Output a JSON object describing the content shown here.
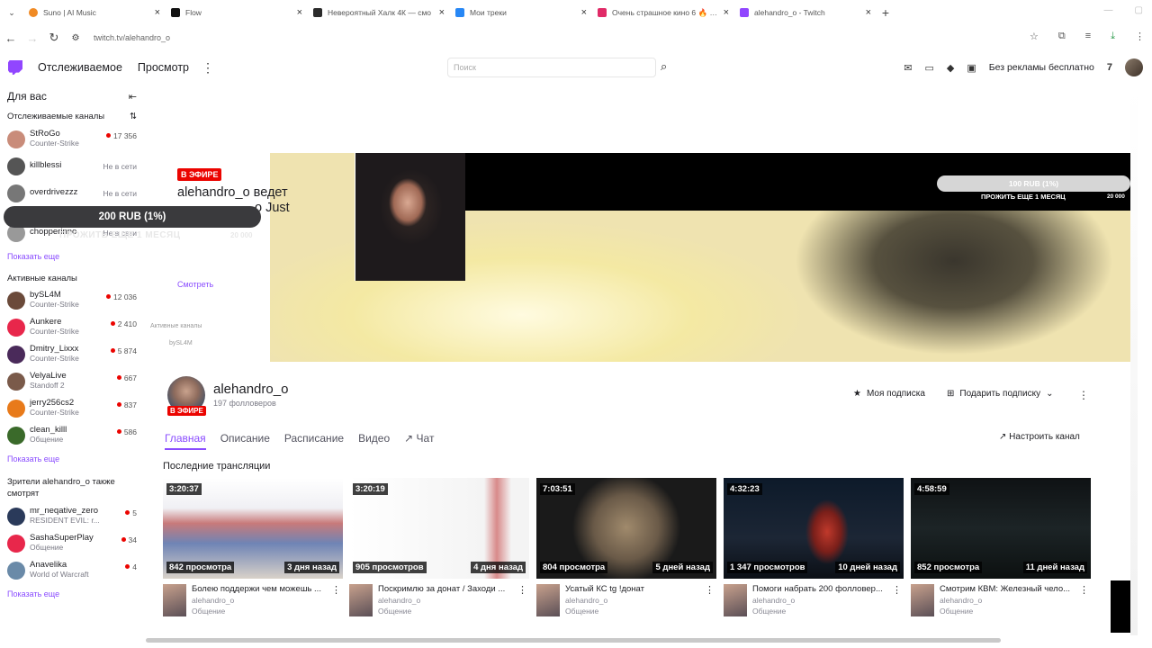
{
  "browser": {
    "tabs": [
      {
        "title": "Suno | AI Music",
        "color": "#f08a24"
      },
      {
        "title": "Flow",
        "color": "#111111"
      },
      {
        "title": "Невероятный Халк 4К — смо",
        "color": "#2b2b2b"
      },
      {
        "title": "Мои треки",
        "color": "#2787f5"
      },
      {
        "title": "Очень страшное кино 6 🔥 ✌",
        "color": "#e02a67"
      },
      {
        "title": "alehandro_o - Twitch",
        "color": "#9146ff"
      }
    ],
    "url": "twitch.tv/alehandro_o"
  },
  "nav": {
    "following": "Отслеживаемое",
    "browse": "Просмотр",
    "search_placeholder": "Поиск",
    "no_ads": "Без рекламы бесплатно"
  },
  "sidebar": {
    "for_you": "Для вас",
    "followed_header": "Отслеживаемые каналы",
    "followed": [
      {
        "name": "StRoGo",
        "game": "Counter-Strike",
        "viewers": "17 356",
        "color": "#c98c7a"
      },
      {
        "name": "killblessi",
        "offline": "Не в сети",
        "color": "#555555"
      },
      {
        "name": "overdrivezzz",
        "offline": "Не в сети",
        "color": "#777777"
      },
      {
        "name": "chopperinno",
        "offline": "Не в сети",
        "color": "#999999"
      }
    ],
    "show_more_1": "Показать еще",
    "active_header": "Активные каналы",
    "active": [
      {
        "name": "bySL4M",
        "game": "Counter-Strike",
        "viewers": "12 036",
        "color": "#6b4a3a"
      },
      {
        "name": "Aunkere",
        "game": "Counter-Strike",
        "viewers": "2 410",
        "color": "#e8274b"
      },
      {
        "name": "Dmitry_Lixxx",
        "game": "Counter-Strike",
        "viewers": "5 874",
        "color": "#4a2a5a"
      },
      {
        "name": "VelyaLive",
        "game": "Standoff 2",
        "viewers": "667",
        "color": "#7a5a4a"
      },
      {
        "name": "jerry256cs2",
        "game": "Counter-Strike",
        "viewers": "837",
        "color": "#e87a1a"
      },
      {
        "name": "clean_killl",
        "game": "Общение",
        "viewers": "586",
        "color": "#3a6a2a"
      }
    ],
    "show_more_2": "Показать еще",
    "viewers_also_header": "Зрители alehandro_o также смотрят",
    "also": [
      {
        "name": "mr_neqative_zero",
        "game": "RESIDENT EVIL: r...",
        "viewers": "5",
        "color": "#2a3a5a"
      },
      {
        "name": "SashaSuperPlay",
        "game": "Общение",
        "viewers": "34",
        "color": "#e8274b"
      },
      {
        "name": "Anavelika",
        "game": "World of Warcraft",
        "viewers": "4",
        "color": "#6a8aa8"
      }
    ],
    "show_more_3": "Показать еще"
  },
  "donation": {
    "amount": "200 RUB (1%)",
    "sub": "ПРОЖИТЬ ЕЩЕ 1 МЕСЯЦ",
    "target": "20 000"
  },
  "stream": {
    "live_badge": "В ЭФИРЕ",
    "title_line1": "alehandro_o ведет",
    "title_line2": "o Just",
    "watch": "Смотреть",
    "side_frag": "Активные каналы",
    "side_frag2": "bySL4M",
    "goal": "100 RUB (1%)",
    "goal_sub": "ПРОЖИТЬ ЕЩЕ 1 МЕСЯЦ",
    "goal_target": "20 000"
  },
  "channel": {
    "name": "alehandro_o",
    "followers": "197 фолловеров",
    "live_badge": "В ЭФИРЕ",
    "subscribe": "Моя подписка",
    "gift": "Подарить подписку",
    "tabs": [
      "Главная",
      "Описание",
      "Расписание",
      "Видео",
      "Чат"
    ],
    "setup": "Настроить канал",
    "recent": "Последние трансляции"
  },
  "videos": [
    {
      "duration": "3:20:37",
      "views": "842 просмотра",
      "ago": "3 дня назад",
      "title": "Болею поддержи чем можешь ...",
      "channel": "alehandro_o",
      "game": "Общение",
      "bg": "#e9e9ef"
    },
    {
      "duration": "3:20:19",
      "views": "905 просмотров",
      "ago": "4 дня назад",
      "title": "Поскримлю за донат / Заходи ...",
      "channel": "alehandro_o",
      "game": "Общение",
      "bg": "#f6f6f6"
    },
    {
      "duration": "7:03:51",
      "views": "804 просмотра",
      "ago": "5 дней назад",
      "title": "Усатый КС tg !донат",
      "channel": "alehandro_o",
      "game": "Общение",
      "bg": "#5a4a3c"
    },
    {
      "duration": "4:32:23",
      "views": "1 347 просмотров",
      "ago": "10 дней назад",
      "title": "Помоги набрать 200 фолловер...",
      "channel": "alehandro_o",
      "game": "Общение",
      "bg": "#1c2635"
    },
    {
      "duration": "4:58:59",
      "views": "852 просмотра",
      "ago": "11 дней назад",
      "title": "Смотрим КВМ: Железный чело...",
      "channel": "alehandro_o",
      "game": "Общение",
      "bg": "#151a1c"
    }
  ]
}
